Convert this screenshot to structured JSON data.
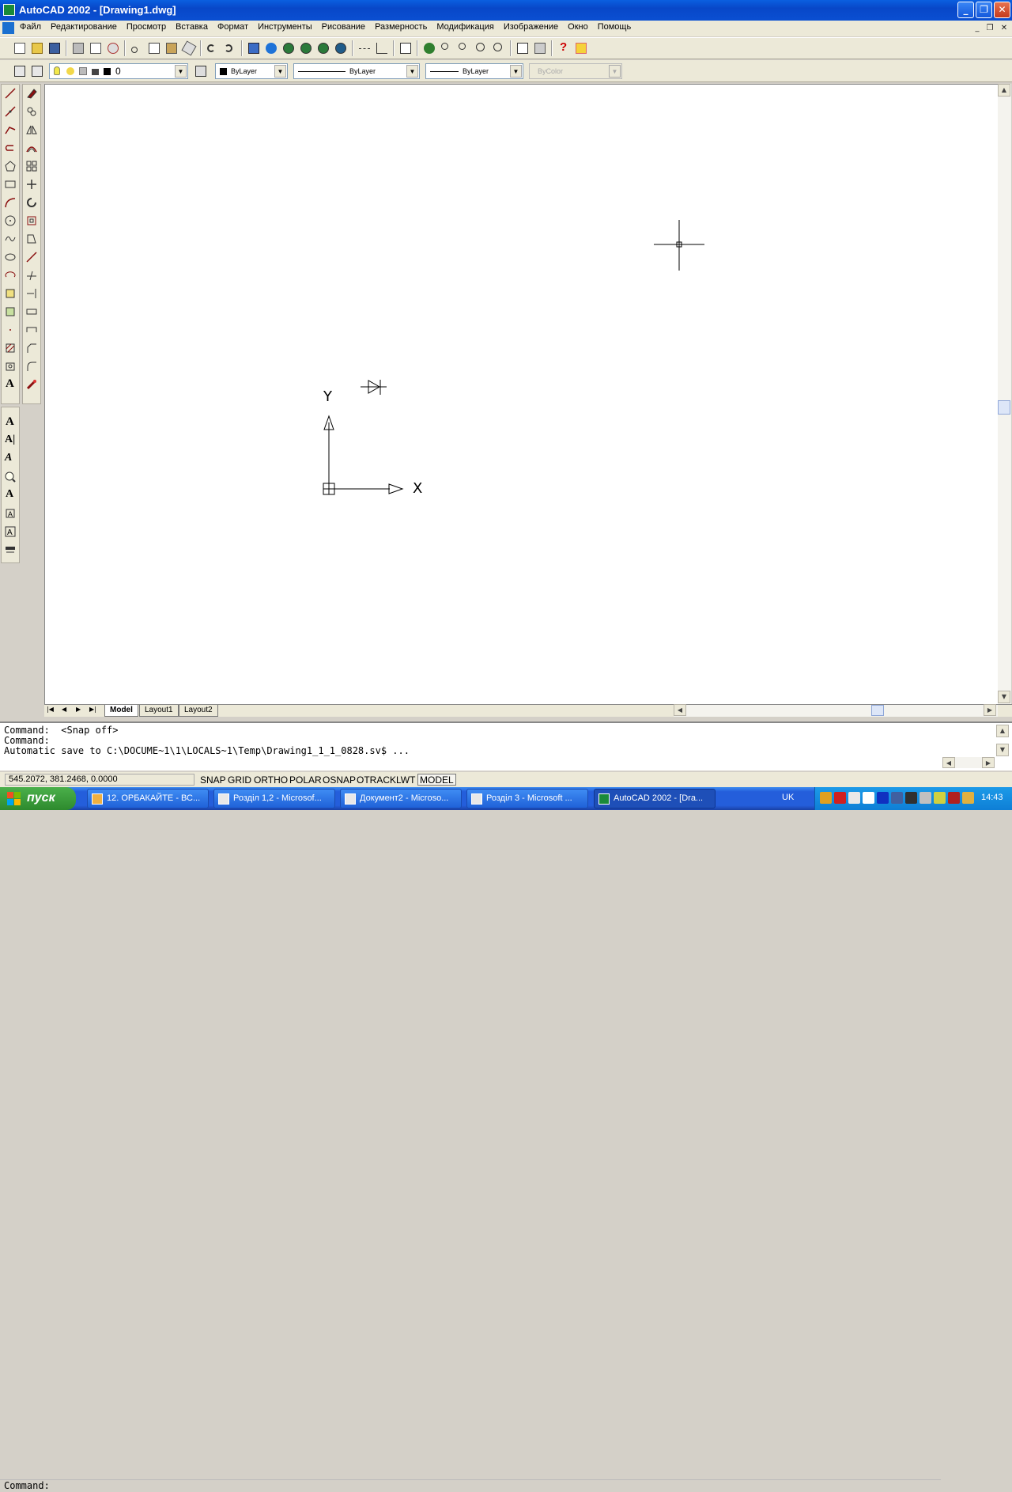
{
  "window": {
    "title": "AutoCAD 2002 - [Drawing1.dwg]",
    "minimize_glyph": "_",
    "maximize_glyph": "❐",
    "close_glyph": "✕"
  },
  "menubar": {
    "items": [
      "Файл",
      "Редактирование",
      "Просмотр",
      "Вставка",
      "Формат",
      "Инструменты",
      "Рисование",
      "Размерность",
      "Модификация",
      "Изображение",
      "Окно",
      "Помощь"
    ],
    "mdi_min": "_",
    "mdi_restore": "❐",
    "mdi_close": "✕"
  },
  "properties_toolbar": {
    "layer_value": "0",
    "color_value": "ByLayer",
    "linetype_value": "ByLayer",
    "lineweight_value": "ByLayer",
    "plotstyle_value": "ByColor"
  },
  "canvas": {
    "ucs_y_label": "Y",
    "ucs_x_label": "X"
  },
  "layout_tabs": [
    "Model",
    "Layout1",
    "Layout2"
  ],
  "command_history": [
    "Command:  <Snap off>",
    "Command:",
    "Automatic save to C:\\DOCUME~1\\1\\LOCALS~1\\Temp\\Drawing1_1_1_0828.sv$ ...",
    "Command:"
  ],
  "statusbar": {
    "coordinates": "545.2072,  381.2468, 0.0000",
    "toggles": [
      {
        "label": "SNAP",
        "on": false
      },
      {
        "label": "GRID",
        "on": false
      },
      {
        "label": "ORTHO",
        "on": false
      },
      {
        "label": "POLAR",
        "on": false
      },
      {
        "label": "OSNAP",
        "on": false
      },
      {
        "label": "OTRACK",
        "on": false
      },
      {
        "label": "LWT",
        "on": false
      },
      {
        "label": "MODEL",
        "on": true
      }
    ]
  },
  "taskbar": {
    "start_label": "пуск",
    "tasks": [
      {
        "label": "12. ОРБАКАЙТЕ - ВС...",
        "active": false
      },
      {
        "label": "Розділ 1,2 - Microsof...",
        "active": false
      },
      {
        "label": "Документ2 - Microso...",
        "active": false
      },
      {
        "label": "Розділ 3 - Microsoft ...",
        "active": false
      },
      {
        "label": "AutoCAD 2002 - [Dra...",
        "active": true
      }
    ],
    "language": "UK",
    "clock": "14:43"
  },
  "colors": {
    "titlebar": "#0a4fd2",
    "canvas": "#ffffff",
    "chrome": "#ece9d8",
    "taskbar": "#245edb",
    "start": "#2d8a2d"
  }
}
